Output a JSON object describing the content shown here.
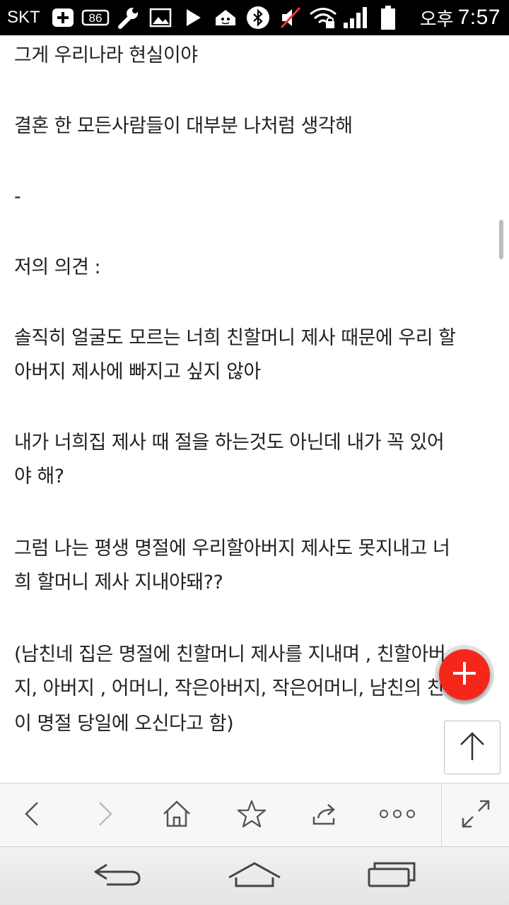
{
  "status_bar": {
    "carrier": "SKT",
    "badge_count": "86",
    "ampm": "오후",
    "time": "7:57",
    "icons": [
      "plus-notification-icon",
      "badge-86-icon",
      "wrench-icon",
      "image-icon",
      "play-icon",
      "home-app-icon",
      "bluetooth-icon",
      "mute-icon",
      "wifi-locked-icon",
      "signal-icon",
      "battery-icon"
    ]
  },
  "article": {
    "lines": [
      "그게 우리나라 현실이야",
      "결혼 한 모든사람들이 대부분 나처럼 생각해",
      "-",
      "저의 의견 :",
      "솔직히 얼굴도 모르는 너희 친할머니 제사 때문에 우리 할",
      "아버지 제사에 빠지고 싶지 않아",
      "내가 너희집 제사 때 절을 하는것도 아닌데 내가 꼭 있어",
      "야 해?",
      "그럼 나는 평생 명절에 우리할아버지 제사도 못지내고 너",
      "희 할머니 제사 지내야돼??",
      "(남친네 집은 명절에 친할머니 제사를 지내며 , 친할아버",
      "지, 아버지 , 어머니, 작은아버지, 작은어머니, 남친의 친형",
      "이 명절 당일에 오신다고 함)"
    ]
  },
  "floating": {
    "fab_icon": "plus-icon",
    "top_icon": "arrow-up-icon",
    "fab_color": "#f4271a"
  },
  "toolbar": {
    "buttons": [
      "back-icon",
      "forward-icon",
      "home-icon",
      "star-icon",
      "share-icon",
      "more-icon",
      "fullscreen-icon"
    ]
  },
  "nav_bar": {
    "buttons": [
      "back-nav-icon",
      "home-nav-icon",
      "recent-apps-icon"
    ]
  }
}
